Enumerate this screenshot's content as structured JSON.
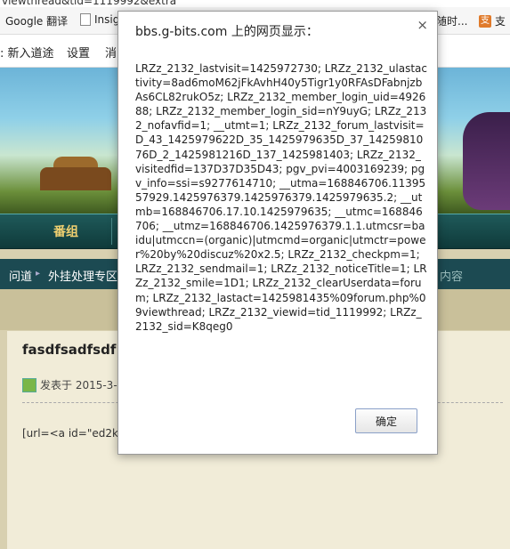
{
  "page": {
    "url_fragment": "viewthread&tid=1119992&extra",
    "bookmarks": [
      "Google 翻译",
      "Insig",
      "随时...",
      "支"
    ],
    "nav_links": [
      "新入道途",
      "设置",
      "消"
    ],
    "menu": [
      "番组"
    ],
    "breadcrumb": [
      "问道",
      "外挂处理专区"
    ],
    "breadcrumb_right": "内容",
    "post": {
      "title": "fasdfsadfsdf (",
      "meta": "发表于 2015-3-1",
      "body": "[url=<a id=\"ed2k_"
    }
  },
  "dialog": {
    "title": "bbs.g-bits.com 上的网页显示：",
    "close": "×",
    "message": "LRZz_2132_lastvisit=1425972730; LRZz_2132_ulastactivity=8ad6moM62jFkAvhH40y5Tigr1y0RFAsDFabnjzbAs6CL82rukO5z; LRZz_2132_member_login_uid=492688; LRZz_2132_member_login_sid=nY9uyG; LRZz_2132_nofavfid=1; __utmt=1; LRZz_2132_forum_lastvisit=D_43_1425979622D_35_1425979635D_37_1425981076D_2_1425981216D_137_1425981403; LRZz_2132_visitedfid=137D37D35D43; pgv_pvi=4003169239; pgv_info=ssi=s9277614710; __utma=168846706.1139557929.1425976379.1425976379.1425979635.2; __utmb=168846706.17.10.1425979635; __utmc=168846706; __utmz=168846706.1425976379.1.1.utmcsr=baidu|utmccn=(organic)|utmcmd=organic|utmctr=power%20by%20discuz%20x2.5; LRZz_2132_checkpm=1; LRZz_2132_sendmail=1; LRZz_2132_noticeTitle=1; LRZz_2132_smile=1D1; LRZz_2132_clearUserdata=forum; LRZz_2132_lastact=1425981435%09forum.php%09viewthread; LRZz_2132_viewid=tid_1119992; LRZz_2132_sid=K8qeg0",
    "ok_label": "确定"
  }
}
